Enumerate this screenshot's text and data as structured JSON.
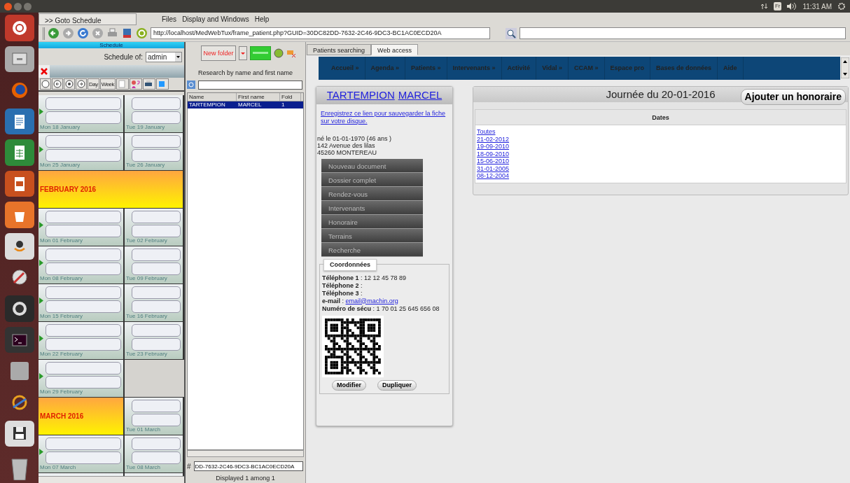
{
  "topbar": {
    "keyboard": "Fr",
    "time": "11:31 AM"
  },
  "menubar": {
    "goto_tab": ">> Goto Schedule",
    "menus": [
      "Files",
      "Display and Windows",
      "Help"
    ]
  },
  "toolbar": {
    "url": "http://localhost/MedWebTux/frame_patient.php?GUID=30DC82DD-7632-2C46-9DC3-BC1AC0ECD20A"
  },
  "schedule": {
    "header": "Schedule",
    "owner_label": "Schedule of:",
    "owner": "admin",
    "view_buttons": [
      "Day",
      "Week"
    ],
    "rows": [
      [
        {
          "kind": "day",
          "label": "Mon 18 January"
        },
        {
          "kind": "day",
          "label": "Tue 19 January"
        }
      ],
      [
        {
          "kind": "day",
          "label": "Mon 25 January"
        },
        {
          "kind": "day",
          "label": "Tue 26 January"
        }
      ],
      [
        {
          "kind": "month",
          "label": "FEBRUARY 2016"
        }
      ],
      [
        {
          "kind": "day",
          "label": "Mon 01 February"
        },
        {
          "kind": "day",
          "label": "Tue 02 February"
        }
      ],
      [
        {
          "kind": "day",
          "label": "Mon 08 February"
        },
        {
          "kind": "day",
          "label": "Tue 09 February"
        }
      ],
      [
        {
          "kind": "day",
          "label": "Mon 15 February"
        },
        {
          "kind": "day",
          "label": "Tue 16 February"
        }
      ],
      [
        {
          "kind": "day",
          "label": "Mon 22 February"
        },
        {
          "kind": "day",
          "label": "Tue 23 February"
        }
      ],
      [
        {
          "kind": "day",
          "label": "Mon 29 February"
        },
        {
          "kind": "empty"
        }
      ],
      [
        {
          "kind": "month",
          "label": "MARCH 2016"
        },
        {
          "kind": "day",
          "label": "Tue 01 March"
        }
      ],
      [
        {
          "kind": "day",
          "label": "Mon 07 March"
        },
        {
          "kind": "day",
          "label": "Tue 08 March"
        }
      ]
    ]
  },
  "patients": {
    "new_folder": "New folder",
    "search_label": "Research by name and first name",
    "columns": [
      "Name",
      "First name",
      "Fold"
    ],
    "rows": [
      {
        "cells": [
          "TARTEMPION",
          "MARCEL",
          "1"
        ],
        "selected": true
      }
    ],
    "guid_label": "#",
    "guid": "DD-7632-2C46-9DC3-BC1AC0ECD20A",
    "status": "Displayed 1 among 1"
  },
  "web": {
    "tabs": [
      {
        "label": "Patients searching",
        "selected": false
      },
      {
        "label": "Web access",
        "selected": true
      }
    ],
    "nav": [
      "Accueil »",
      "Agenda »",
      "Patients »",
      "Intervenants »",
      "Activité",
      "Vidal »",
      "CCAM »",
      "Espace pro",
      "Bases de données",
      "Aide"
    ],
    "patient": {
      "last_name": "TARTEMPION",
      "first_name": "MARCEL",
      "save_link": "Enregistrez ce lien pour sauvegarder la fiche sur votre disque.",
      "details": [
        "né le 01-01-1970 (46 ans )",
        "142 Avenue des lilas",
        "45260 MONTEREAU"
      ],
      "menu": [
        "Nouveau document",
        "Dossier complet",
        "Rendez-vous",
        "Intervenants",
        "Honoraire",
        "Terrains",
        "Recherche"
      ],
      "contact_title": "Coordonnées",
      "contact": [
        {
          "kind": "text",
          "text": "**Téléphone 1** : 12 12 45 78 89"
        },
        {
          "kind": "text",
          "text": "**Téléphone 2** :"
        },
        {
          "kind": "text",
          "text": "**Téléphone 3** :"
        },
        {
          "kind": "link",
          "text": "**e-mail** :",
          "link": "email@machin.org"
        },
        {
          "kind": "text",
          "text": "**Numéro de sécu** : 1 70 01 25 645 656 08"
        }
      ],
      "buttons": [
        "Modifier",
        "Dupliquer"
      ]
    },
    "day": {
      "title": "Journée du 20-01-2016",
      "add_button": "Ajouter un honoraire",
      "column": "Dates",
      "dates": [
        "Toutes",
        "21-02-2012",
        "19-09-2010",
        "18-09-2010",
        "15-06-2010",
        "31-01-2005",
        "08-12-2004"
      ]
    }
  }
}
